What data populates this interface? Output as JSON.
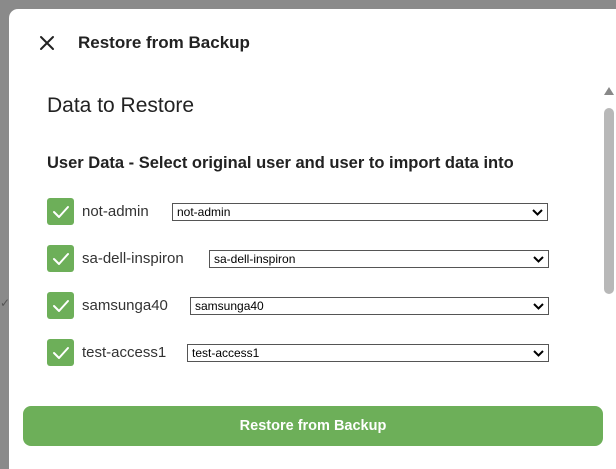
{
  "dialog": {
    "title": "Restore from Backup",
    "close_icon": "close-icon"
  },
  "section": {
    "title": "Data to Restore",
    "subtitle": "User Data - Select original user and user to import data into"
  },
  "users": [
    {
      "label": "not-admin",
      "checked": true,
      "selected": "not-admin"
    },
    {
      "label": "sa-dell-inspiron",
      "checked": true,
      "selected": "sa-dell-inspiron"
    },
    {
      "label": "samsunga40",
      "checked": true,
      "selected": "samsunga40"
    },
    {
      "label": "test-access1",
      "checked": true,
      "selected": "test-access1"
    }
  ],
  "actions": {
    "restore_label": "Restore from Backup"
  },
  "colors": {
    "accent": "#6daf59",
    "text": "#222222",
    "backdrop": "#8a8a8a"
  }
}
